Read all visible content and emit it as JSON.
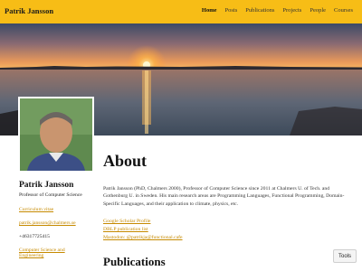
{
  "navbar": {
    "brand": "Patrik Jansson",
    "items": [
      {
        "label": "Home",
        "active": true
      },
      {
        "label": "Posts"
      },
      {
        "label": "Publications"
      },
      {
        "label": "Projects"
      },
      {
        "label": "People"
      },
      {
        "label": "Courses"
      }
    ],
    "color": "#f7bd16"
  },
  "banner": {
    "description_icon": "sunset-over-sea-image"
  },
  "profile": {
    "name": "Patrik Jansson",
    "role": "Professor of Computer Science",
    "cv": "Curriculum vitae",
    "email": "patrik.jansson@chalmers.se",
    "phone": "+46317725415",
    "department_line1": "Computer Science and",
    "department_line2": "Engineering"
  },
  "about": {
    "heading": "About",
    "bio": "Patrik Jansson (PhD, Chalmers 2000), Professor of Computer Science since 2011 at Chalmers U. of Tech. and Gothenburg U. in Sweden. His main research areas are Programming Languages, Functional Programming, Domain-Specific Languages, and their application to climate, physics, etc.",
    "links": [
      "Google Scholar Profile",
      "DBLP publication list",
      "Mastodon: @patrikja@functional.cafe"
    ]
  },
  "publications": {
    "heading": "Publications"
  },
  "tools_button": "Tools",
  "link_color": "#c68a00"
}
